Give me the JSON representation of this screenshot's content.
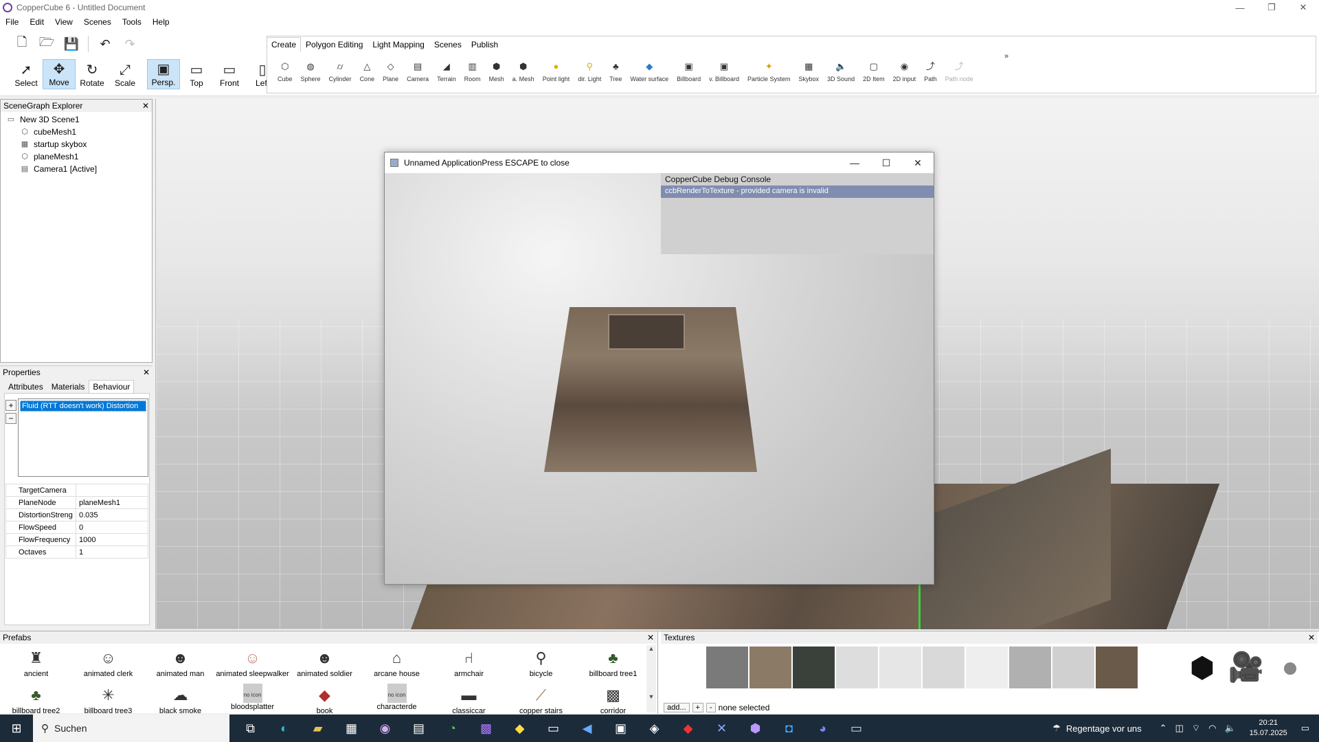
{
  "window": {
    "title": "CopperCube 6 - Untitled Document",
    "minimize": "—",
    "maximize": "❐",
    "close": "✕"
  },
  "menu": [
    "File",
    "Edit",
    "View",
    "Scenes",
    "Tools",
    "Help"
  ],
  "modes": [
    {
      "label": "Select",
      "icon": "cursor-icon"
    },
    {
      "label": "Move",
      "icon": "move-icon",
      "active": true
    },
    {
      "label": "Rotate",
      "icon": "rotate-icon"
    },
    {
      "label": "Scale",
      "icon": "scale-icon"
    },
    {
      "label": "Persp.",
      "icon": "perspective-icon",
      "active": true
    },
    {
      "label": "Top",
      "icon": "top-view-icon"
    },
    {
      "label": "Front",
      "icon": "front-view-icon"
    },
    {
      "label": "Left",
      "icon": "left-view-icon"
    }
  ],
  "ribbon": {
    "tabs": [
      "Create",
      "Polygon Editing",
      "Light Mapping",
      "Scenes",
      "Publish"
    ],
    "selected_tab": "Create",
    "tools": [
      "Cube",
      "Sphere",
      "Cylinder",
      "Cone",
      "Plane",
      "Camera",
      "Terrain",
      "Room",
      "Mesh",
      "a. Mesh",
      "Point light",
      "dir. Light",
      "Tree",
      "Water surface",
      "Billboard",
      "v. Billboard",
      "Particle System",
      "Skybox",
      "3D Sound",
      "2D Item",
      "2D input",
      "Path",
      "Path node"
    ],
    "more": "»"
  },
  "scenegraph": {
    "title": "SceneGraph Explorer",
    "root": "New 3D Scene1",
    "children": [
      "cubeMesh1",
      "startup skybox",
      "planeMesh1",
      "Camera1 [Active]"
    ]
  },
  "properties": {
    "title": "Properties",
    "tabs": [
      "Attributes",
      "Materials",
      "Behaviour"
    ],
    "selected_tab": "Behaviour",
    "behaviour": "Fluid (RTT doesn't work) Distortion",
    "add": "+",
    "remove": "−",
    "rows": [
      {
        "key": "TargetCamera",
        "value": ""
      },
      {
        "key": "PlaneNode",
        "value": "planeMesh1"
      },
      {
        "key": "DistortionStreng",
        "value": "0.035"
      },
      {
        "key": "FlowSpeed",
        "value": "0"
      },
      {
        "key": "FlowFrequency",
        "value": "1000"
      },
      {
        "key": "Octaves",
        "value": "1"
      }
    ]
  },
  "popup": {
    "title": "Unnamed ApplicationPress ESCAPE to close",
    "console_title": "CopperCube Debug Console",
    "console_line": "ccbRenderToTexture - provided camera is invalid"
  },
  "prefabs": {
    "title": "Prefabs",
    "items": [
      {
        "label": "ancient",
        "icon": "statue-icon"
      },
      {
        "label": "animated clerk",
        "icon": "person-icon"
      },
      {
        "label": "animated man",
        "icon": "person-icon"
      },
      {
        "label": "animated sleepwalker",
        "icon": "person-icon"
      },
      {
        "label": "animated soldier",
        "icon": "soldier-icon"
      },
      {
        "label": "arcane house",
        "icon": "house-icon"
      },
      {
        "label": "armchair",
        "icon": "armchair-icon"
      },
      {
        "label": "bicycle",
        "icon": "bicycle-icon"
      },
      {
        "label": "billboard tree1",
        "icon": "tree-icon"
      },
      {
        "label": "billboard tree2",
        "icon": "tree-icon"
      },
      {
        "label": "billboard tree3",
        "icon": "tree-icon"
      },
      {
        "label": "black smoke",
        "icon": "smoke-icon"
      },
      {
        "label": "bloodsplatter",
        "icon": "no-icon",
        "noicon": "no icon"
      },
      {
        "label": "book",
        "icon": "book-icon"
      },
      {
        "label": "characterde",
        "icon": "no-icon",
        "noicon": "no icon"
      },
      {
        "label": "classiccar",
        "icon": "car-icon"
      },
      {
        "label": "copper stairs",
        "icon": "stairs-icon"
      },
      {
        "label": "corridor",
        "icon": "corridor-icon"
      }
    ]
  },
  "textures": {
    "title": "Textures",
    "add": "add...",
    "plus": "+",
    "minus": "-",
    "status": "none selected"
  },
  "taskbar": {
    "search": "Suchen",
    "weather": "Regentage vor uns",
    "time": "20:21",
    "date": "15.07.2025"
  }
}
